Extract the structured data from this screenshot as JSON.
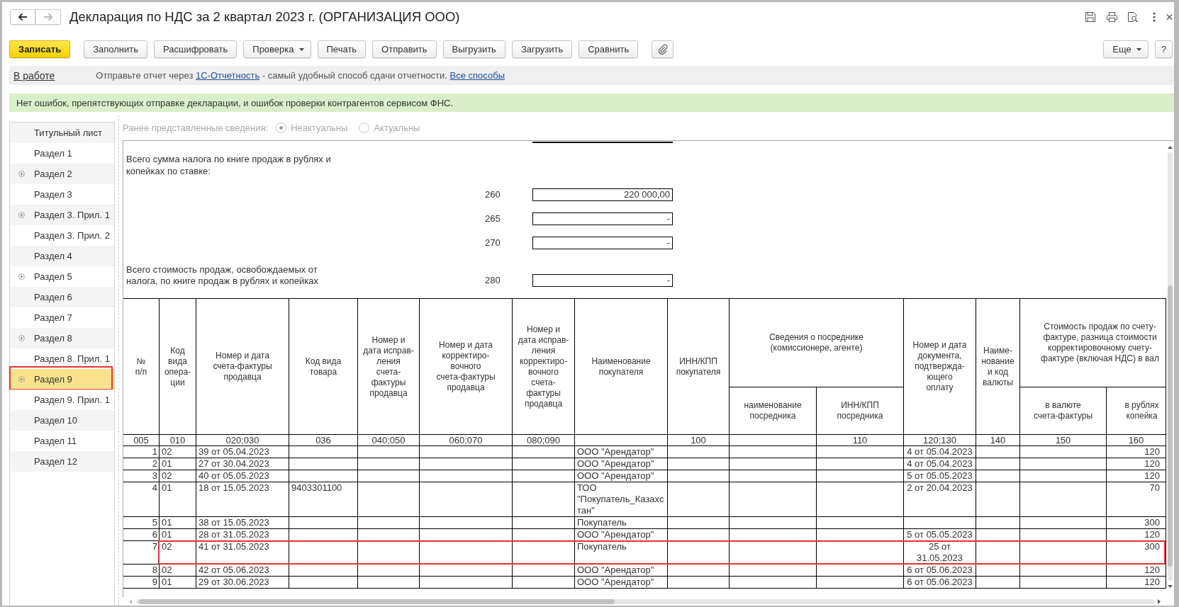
{
  "window": {
    "title": "Декларация по НДС за 2 квартал 2023 г. (ОРГАНИЗАЦИЯ ООО)",
    "nav_buttons": [
      {
        "kind": "back",
        "disabled": false
      },
      {
        "kind": "forward",
        "disabled": true
      }
    ]
  },
  "toolbar": {
    "buttons": [
      {
        "label": "Записать",
        "kind": "primary"
      },
      {
        "label": "Заполнить",
        "kind": "plain"
      },
      {
        "label": "Расшифровать",
        "kind": "plain"
      },
      {
        "label": "Проверка",
        "kind": "dropdown"
      },
      {
        "label": "Печать",
        "kind": "plain"
      },
      {
        "label": "Отправить",
        "kind": "plain"
      },
      {
        "label": "Выгрузить",
        "kind": "plain"
      },
      {
        "label": "Загрузить",
        "kind": "plain"
      },
      {
        "label": "Сравнить",
        "kind": "plain"
      }
    ],
    "right_buttons": [
      {
        "label": "Еще",
        "kind": "dropdown"
      },
      {
        "label": "?",
        "kind": "plain"
      }
    ]
  },
  "status_bar": {
    "status": "В работе",
    "message": [
      {
        "kind": "text",
        "text": "Отправьте отчет через"
      },
      {
        "kind": "link",
        "text": "1С-Отчетность"
      },
      {
        "kind": "text",
        "text": "- самый удобный способ сдачи отчетности."
      },
      {
        "kind": "link",
        "text": "Все способы"
      }
    ]
  },
  "notice": {
    "text": "Нет ошибок, препятствующих отправке декларации, и ошибок проверки контрагентов сервисом ФНС."
  },
  "sidebar": {
    "items": [
      {
        "label": "Титульный лист",
        "expandable": false,
        "selected": false,
        "highlighted": false
      },
      {
        "label": "Раздел 1",
        "expandable": false,
        "selected": false,
        "highlighted": false
      },
      {
        "label": "Раздел 2",
        "expandable": true,
        "selected": false,
        "highlighted": false
      },
      {
        "label": "Раздел 3",
        "expandable": false,
        "selected": false,
        "highlighted": false
      },
      {
        "label": "Раздел 3. Прил. 1",
        "expandable": true,
        "selected": false,
        "highlighted": false
      },
      {
        "label": "Раздел 3. Прил. 2",
        "expandable": false,
        "selected": false,
        "highlighted": false
      },
      {
        "label": "Раздел 4",
        "expandable": false,
        "selected": false,
        "highlighted": false
      },
      {
        "label": "Раздел 5",
        "expandable": true,
        "selected": false,
        "highlighted": false
      },
      {
        "label": "Раздел 6",
        "expandable": false,
        "selected": false,
        "highlighted": false
      },
      {
        "label": "Раздел 7",
        "expandable": false,
        "selected": false,
        "highlighted": false
      },
      {
        "label": "Раздел 8",
        "expandable": true,
        "selected": false,
        "highlighted": false
      },
      {
        "label": "Раздел 8. Прил. 1",
        "expandable": false,
        "selected": false,
        "highlighted": false
      },
      {
        "label": "Раздел 9",
        "expandable": true,
        "selected": true,
        "highlighted": true
      },
      {
        "label": "Раздел 9. Прил. 1",
        "expandable": false,
        "selected": false,
        "highlighted": false
      },
      {
        "label": "Раздел 10",
        "expandable": false,
        "selected": false,
        "highlighted": false
      },
      {
        "label": "Раздел 11",
        "expandable": false,
        "selected": false,
        "highlighted": false
      },
      {
        "label": "Раздел 12",
        "expandable": false,
        "selected": false,
        "highlighted": false
      }
    ]
  },
  "previous_info": {
    "label": "Ранее представленные сведения:",
    "disabled": true,
    "options": [
      {
        "label": "Неактуальны",
        "selected": true
      },
      {
        "label": "Актуальны",
        "selected": false
      }
    ]
  },
  "form": {
    "sections": [
      {
        "kind": "heading",
        "text": "Всего сумма налога по книге продаж в рублях и\nкопейках по ставке:",
        "lines": [
          {
            "code": "260",
            "value": "220 000,00"
          },
          {
            "code": "265",
            "value": "-"
          },
          {
            "code": "270",
            "value": "-"
          }
        ]
      },
      {
        "kind": "inline",
        "text": "Всего стоимость продаж, освобождаемых от\nналога, по книге продаж в рублях и копейках",
        "lines": [
          {
            "code": "280",
            "value": "-"
          }
        ]
      }
    ]
  },
  "table": {
    "header": [
      {
        "label": "№\nп/п",
        "code": "005"
      },
      {
        "label": "Код\nвида\nопера-\nции",
        "code": "010"
      },
      {
        "label": "Номер и дата\nсчета-фактуры\nпродавца",
        "code": "020;030"
      },
      {
        "label": "Код вида\nтовара",
        "code": "036"
      },
      {
        "label": "Номер и\nдата исправ-\nления\nсчета-\nфактуры\nпродавца",
        "code": "040;050"
      },
      {
        "label": "Номер и дата\nкорректиро-\nвочного\nсчета-фактуры\nпродавца",
        "code": "060;070"
      },
      {
        "label": "Номер и\nдата исправ-\nления\nкорректиро-\nвочного\nсчета-\nфактуры\nпродавца",
        "code": "080;090"
      },
      {
        "label": "Наименование\nпокупателя"
      },
      {
        "label": "ИНН/КПП\nпокупателя",
        "code": "100"
      },
      {
        "label": "Сведения о посреднике\n(комиссионере, агенте)",
        "children": [
          {
            "label": "наименование\nпосредника"
          },
          {
            "label": "ИНН/КПП\nпосредника",
            "code": "110"
          }
        ]
      },
      {
        "label": "Номер и дата\nдокумента,\nподтвержда-\nющего\nоплату",
        "code": "120;130"
      },
      {
        "label": "Наиме-\nнование\nи код\nвалюты",
        "code": "140"
      },
      {
        "label": "Стоимость продаж по счету-\nфактуре, разница стоимости\nкорректировочному счету-\nфактуре (включая НДС) в вал",
        "children": [
          {
            "label": "в валюте\nсчета-фактуры",
            "code": "150"
          },
          {
            "label": "в рублях\nкопейка",
            "code": "160"
          }
        ]
      }
    ],
    "rows": [
      {
        "no": "1",
        "operation_code": "02",
        "invoice": "39 от 05.04.2023",
        "buyer": "ООО \"Арендатор\"",
        "payment_document": "4 от 05.04.2023",
        "amount_rub": "120",
        "highlighted": false
      },
      {
        "no": "2",
        "operation_code": "01",
        "invoice": "27 от 30.04.2023",
        "buyer": "ООО \"Арендатор\"",
        "payment_document": "4 от 05.04.2023",
        "amount_rub": "120",
        "highlighted": false
      },
      {
        "no": "3",
        "operation_code": "02",
        "invoice": "40 от 05.05.2023",
        "buyer": "ООО \"Арендатор\"",
        "payment_document": "5 от 05.05.2023",
        "amount_rub": "120",
        "highlighted": false
      },
      {
        "no": "4",
        "operation_code": "01",
        "invoice": "18 от 15.05.2023",
        "goods_code": "9403301100",
        "buyer": "ТОО\n\"Покупатель_Казахс\nтан\"",
        "payment_document": "2 от 20.04.2023",
        "amount_rub": "70",
        "highlighted": false
      },
      {
        "no": "5",
        "operation_code": "01",
        "invoice": "38 от 15.05.2023",
        "buyer": "Покупатель",
        "amount_rub": "300",
        "highlighted": false
      },
      {
        "no": "6",
        "operation_code": "01",
        "invoice": "28 от 31.05.2023",
        "buyer": "ООО \"Арендатор\"",
        "payment_document": "5 от 05.05.2023",
        "amount_rub": "120",
        "highlighted": false
      },
      {
        "no": "7",
        "operation_code": "02",
        "invoice": "41 от 31.05.2023",
        "buyer": "Покупатель",
        "payment_document": "25 от\n31.05.2023",
        "amount_rub": "300",
        "highlighted": true
      },
      {
        "no": "8",
        "operation_code": "02",
        "invoice": "42 от 05.06.2023",
        "buyer": "ООО \"Арендатор\"",
        "payment_document": "6 от 05.06.2023",
        "amount_rub": "120",
        "highlighted": false
      },
      {
        "no": "9",
        "operation_code": "01",
        "invoice": "29 от 30.06.2023",
        "buyer": "ООО \"Арендатор\"",
        "payment_document": "6 от 05.06.2023",
        "amount_rub": "120",
        "highlighted": false
      }
    ]
  }
}
